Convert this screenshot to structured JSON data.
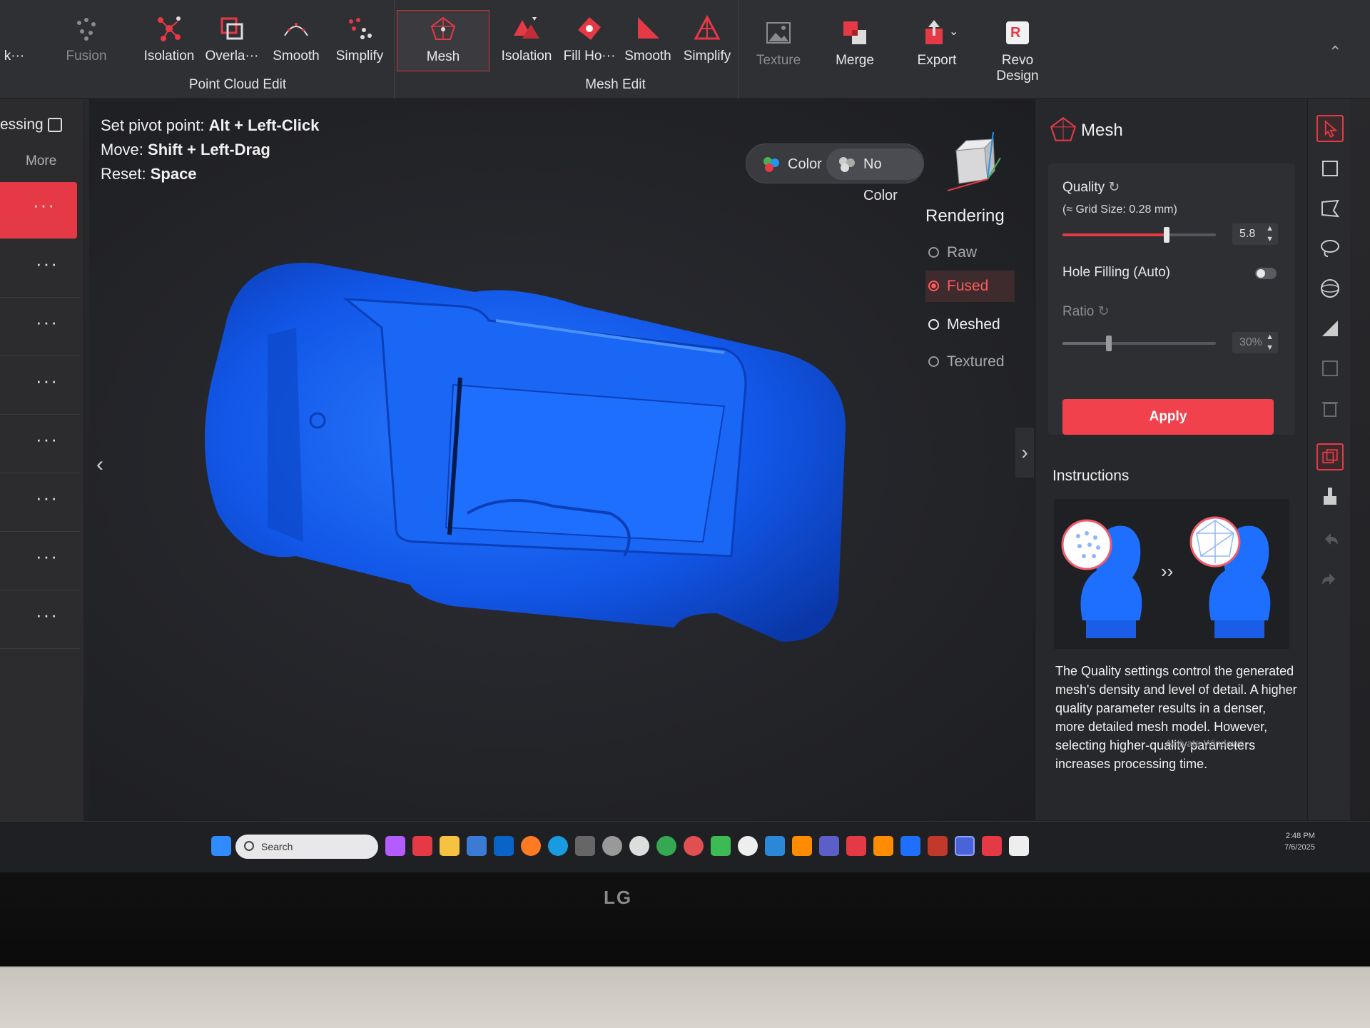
{
  "ribbon": {
    "cut_label": "k···",
    "point_cloud": {
      "fusion": "Fusion",
      "isolation": "Isolation",
      "overlap": "Overla···",
      "smooth": "Smooth",
      "simplify": "Simplify",
      "group_label": "Point Cloud Edit"
    },
    "mesh_btn": "Mesh",
    "mesh_edit": {
      "isolation": "Isolation",
      "fill_holes": "Fill Ho···",
      "smooth": "Smooth",
      "simplify": "Simplify",
      "group_label": "Mesh Edit"
    },
    "texture": "Texture",
    "merge": "Merge",
    "export": "Export",
    "revo_design": "Revo Design",
    "accent_color": "#e63946"
  },
  "left_panel": {
    "title": "essing",
    "more": "More",
    "item_dots": "···"
  },
  "viewport": {
    "hints": [
      {
        "key": "Set pivot point:",
        "value": "Alt + Left-Click"
      },
      {
        "key": "Move:",
        "value": "Shift + Left-Drag"
      },
      {
        "key": "Reset:",
        "value": "Space"
      }
    ],
    "color_toggle": {
      "color": "Color",
      "no_color": "No Color"
    },
    "rendering_title": "Rendering",
    "rendering_options": [
      "Raw",
      "Fused",
      "Meshed",
      "Textured"
    ],
    "rendering_selected": "Fused",
    "model_color": "#1f6fff"
  },
  "right_panel": {
    "title": "Mesh",
    "quality_label": "Quality",
    "grid_size": "(≈ Grid Size: 0.28 mm)",
    "quality_value": "5.8",
    "quality_fraction": 0.68,
    "hole_filling_label": "Hole Filling (Auto)",
    "ratio_label": "Ratio",
    "ratio_value": "30%",
    "ratio_fraction": 0.3,
    "apply": "Apply",
    "instructions_title": "Instructions",
    "instructions_text": "The Quality settings control the generated mesh's density and level of detail. A higher quality parameter results in a denser, more detailed mesh model. However, selecting higher-quality parameters increases processing time.",
    "watermark": "Activate Windows"
  },
  "taskbar": {
    "search": "Search",
    "time": "2:48 PM",
    "date": "7/6/2025"
  },
  "monitor": {
    "brand": "LG"
  }
}
